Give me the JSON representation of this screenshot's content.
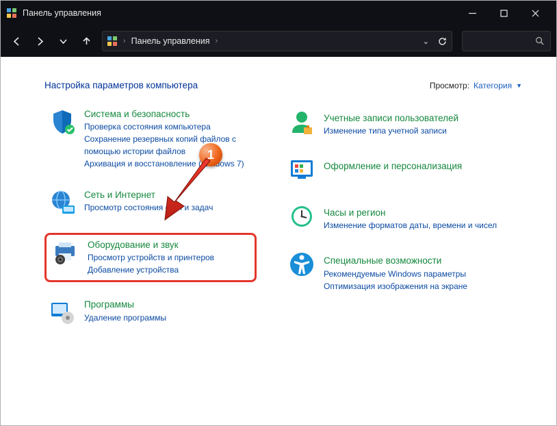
{
  "window": {
    "title": "Панель управления"
  },
  "breadcrumb": {
    "root": "Панель управления"
  },
  "heading": "Настройка параметров компьютера",
  "viewby": {
    "label": "Просмотр:",
    "value": "Категория"
  },
  "annotation": {
    "number": "1"
  },
  "left": [
    {
      "title": "Система и безопасность",
      "links": [
        "Проверка состояния компьютера",
        "Сохранение резервных копий файлов с помощью истории файлов",
        "Архивация и восстановление (Windows 7)"
      ]
    },
    {
      "title": "Сеть и Интернет",
      "links": [
        "Просмотр состояния сети и задач"
      ]
    },
    {
      "title": "Оборудование и звук",
      "links": [
        "Просмотр устройств и принтеров",
        "Добавление устройства"
      ]
    },
    {
      "title": "Программы",
      "links": [
        "Удаление программы"
      ]
    }
  ],
  "right": [
    {
      "title": "Учетные записи пользователей",
      "links": [
        "Изменение типа учетной записи"
      ]
    },
    {
      "title": "Оформление и персонализация",
      "links": []
    },
    {
      "title": "Часы и регион",
      "links": [
        "Изменение форматов даты, времени и чисел"
      ]
    },
    {
      "title": "Специальные возможности",
      "links": [
        "Рекомендуемые Windows параметры",
        "Оптимизация изображения на экране"
      ]
    }
  ]
}
